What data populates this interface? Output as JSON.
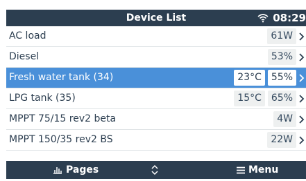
{
  "header": {
    "title": "Device List",
    "time": "08:29",
    "wifi_icon": "wifi-icon"
  },
  "rows": [
    {
      "label": "AC load",
      "values": [
        "61W"
      ],
      "selected": false
    },
    {
      "label": "Diesel",
      "values": [
        "53%"
      ],
      "selected": false
    },
    {
      "label": "Fresh water tank (34)",
      "values": [
        "23°C",
        "55%"
      ],
      "selected": true
    },
    {
      "label": "LPG tank (35)",
      "values": [
        "15°C",
        "65%"
      ],
      "selected": false
    },
    {
      "label": "MPPT 75/15 rev2 beta",
      "values": [
        "4W"
      ],
      "selected": false
    },
    {
      "label": "MPPT 150/35 rev2 BS",
      "values": [
        "22W"
      ],
      "selected": false
    }
  ],
  "footer": {
    "pages_label": "Pages",
    "menu_label": "Menu"
  },
  "colors": {
    "bar": "#2c3e50",
    "selected": "#4a90d9",
    "value_bg": "#eef0f0"
  }
}
